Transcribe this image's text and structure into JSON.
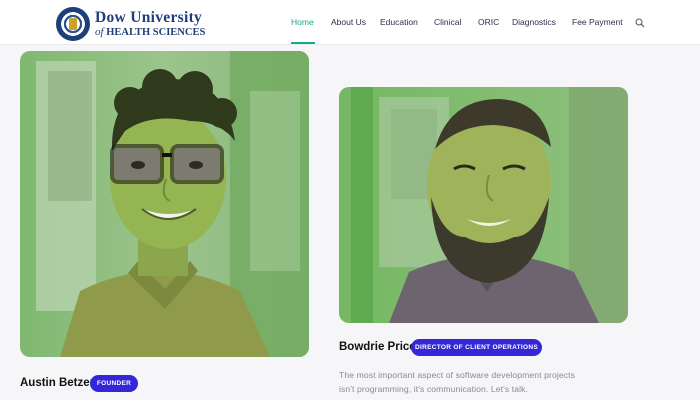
{
  "header": {
    "logo": {
      "line1": "Dow University",
      "line2_of": "of",
      "line2": "HEALTH SCIENCES"
    },
    "nav": [
      {
        "label": "Home",
        "active": true
      },
      {
        "label": "About Us",
        "active": false
      },
      {
        "label": "Education",
        "active": false
      },
      {
        "label": "Clinical",
        "active": false
      },
      {
        "label": "ORIC",
        "active": false
      },
      {
        "label": "Diagnostics",
        "active": false
      },
      {
        "label": "Fee Payment",
        "active": false
      }
    ],
    "search_icon": "search-icon"
  },
  "colors": {
    "accent": "#18a88a",
    "badge": "#3527d8",
    "brand": "#1f3f7a"
  },
  "team": [
    {
      "name": "Austin Betzer",
      "role": "FOUNDER"
    },
    {
      "name": "Bowdrie Price",
      "role": "DIRECTOR OF CLIENT OPERATIONS",
      "quote": "The most important aspect of software development projects isn't programming, it's communication. Let's talk."
    }
  ]
}
